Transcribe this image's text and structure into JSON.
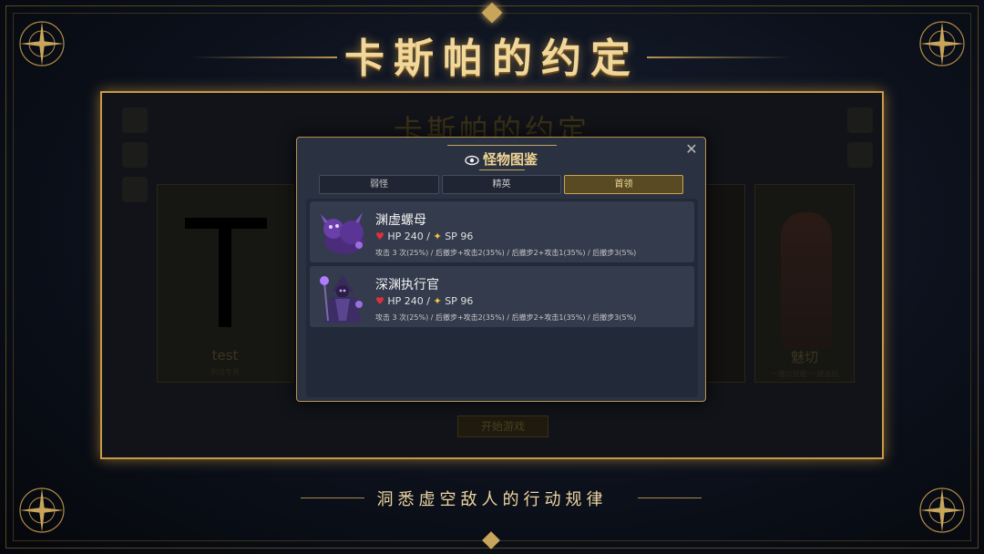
{
  "title": "卡斯帕的约定",
  "subtitle": "洞悉虚空敌人的行动规律",
  "colors": {
    "gold": "#c79a45",
    "modal_bg": "#2a3140",
    "active_tab": "#5a4a23",
    "heart": "#e0303a",
    "spark": "#f6c740"
  },
  "background_game": {
    "title": "卡斯帕的约定",
    "left_card": {
      "label": "test",
      "sub": "测试专用"
    },
    "right_card": {
      "label": "魅切",
      "sub": "一键切技能  一键连招"
    },
    "start_button": "开始游戏"
  },
  "modal": {
    "title": "怪物图鉴",
    "title_icon": "eye-icon",
    "close_label": "✕",
    "tabs": [
      {
        "label": "弱怪",
        "active": false
      },
      {
        "label": "精英",
        "active": false
      },
      {
        "label": "首领",
        "active": true
      }
    ],
    "monsters": [
      {
        "name": "渊虚螺母",
        "hp_text": "HP 240 /",
        "sp_text": "SP 96",
        "pattern": "攻击 3 次(25%) / 后撤步+攻击2(35%) / 后撤步2+攻击1(35%) / 后撤步3(5%)",
        "portrait_icon": "beast-portrait-icon"
      },
      {
        "name": "深渊执行官",
        "hp_text": "HP 240 /",
        "sp_text": "SP 96",
        "pattern": "攻击 3 次(25%) / 后撤步+攻击2(35%) / 后撤步2+攻击1(35%) / 后撤步3(5%)",
        "portrait_icon": "mage-portrait-icon"
      }
    ]
  }
}
